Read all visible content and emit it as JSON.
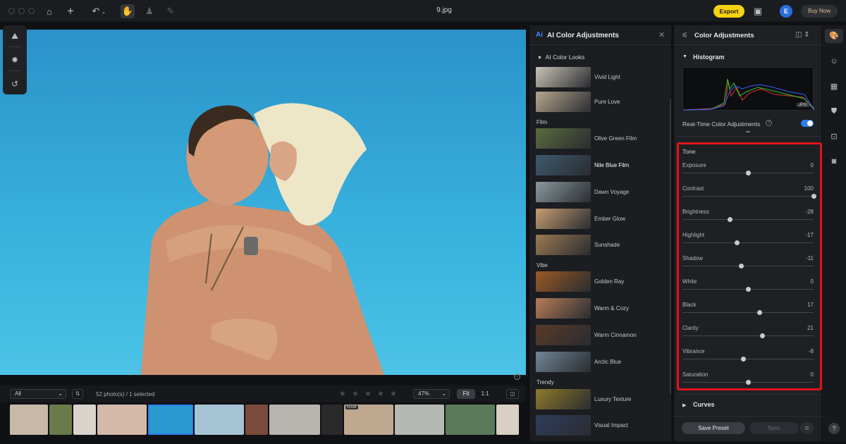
{
  "window": {
    "title": "9.jpg"
  },
  "toolbar": {
    "export_label": "Export",
    "avatar_letter": "E",
    "buy_label": "Buy Now"
  },
  "filmstrip": {
    "album": "All",
    "count_text": "52 photo(s) / 1 selected",
    "zoom": "47%",
    "fit_label": "Fit",
    "one_to_one_label": "1:1",
    "raw_badge": "RAW"
  },
  "ai_panel": {
    "logo": "Ai",
    "title": "AI Color Adjustments",
    "section": "AI Color Looks",
    "groups": [
      "Film",
      "Vibe",
      "Trendy"
    ],
    "looks": [
      {
        "name": "Vivid Light",
        "color": "#c9c3b6"
      },
      {
        "name": "Pure Love",
        "color": "#b7a78e"
      },
      {
        "name": "Olive Green Film",
        "color": "#5b6b3f"
      },
      {
        "name": "Nile Blue Film",
        "color": "#3d5a6e"
      },
      {
        "name": "Dawn Voyage",
        "color": "#8a9aa0"
      },
      {
        "name": "Ember Glow",
        "color": "#c69d72"
      },
      {
        "name": "Sunshade",
        "color": "#9a7a52"
      },
      {
        "name": "Golden Ray",
        "color": "#9a5a24"
      },
      {
        "name": "Warm & Cozy",
        "color": "#b77c57"
      },
      {
        "name": "Warm Cinnamon",
        "color": "#5a3a28"
      },
      {
        "name": "Arctic Blue",
        "color": "#6f8696"
      },
      {
        "name": "Luxury Texture",
        "color": "#8e7a2a"
      },
      {
        "name": "Visual Impact",
        "color": "#2e3c5c"
      }
    ],
    "active_look": "Nile Blue Film"
  },
  "color_panel": {
    "title": "Color Adjustments",
    "histogram_label": "Histogram",
    "jpg_tag": "JPG",
    "realtime_label": "Real-Time Color Adjustments",
    "realtime_help": "?",
    "realtime_on": true,
    "tone_label": "Tone",
    "sliders": [
      {
        "label": "Exposure",
        "value": "0",
        "num": 0
      },
      {
        "label": "Contrast",
        "value": "100",
        "num": 100
      },
      {
        "label": "Brightness",
        "value": "-28",
        "num": -28
      },
      {
        "label": "Highlight",
        "value": "-17",
        "num": -17
      },
      {
        "label": "Shadow",
        "value": "-11",
        "num": -11
      },
      {
        "label": "White",
        "value": "0",
        "num": 0
      },
      {
        "label": "Black",
        "value": "17",
        "num": 17
      },
      {
        "label": "Clarity",
        "value": "21",
        "num": 21
      },
      {
        "label": "Vibrance",
        "value": "-8",
        "num": -8
      },
      {
        "label": "Saturation",
        "value": "0",
        "num": 0
      }
    ],
    "curves_label": "Curves",
    "save_preset_label": "Save Preset",
    "sync_label": "Sync"
  },
  "colors": {
    "accent": "#2a7ff0",
    "export": "#f5d30f",
    "highlight_box": "#e0141b"
  },
  "help_label": "?"
}
